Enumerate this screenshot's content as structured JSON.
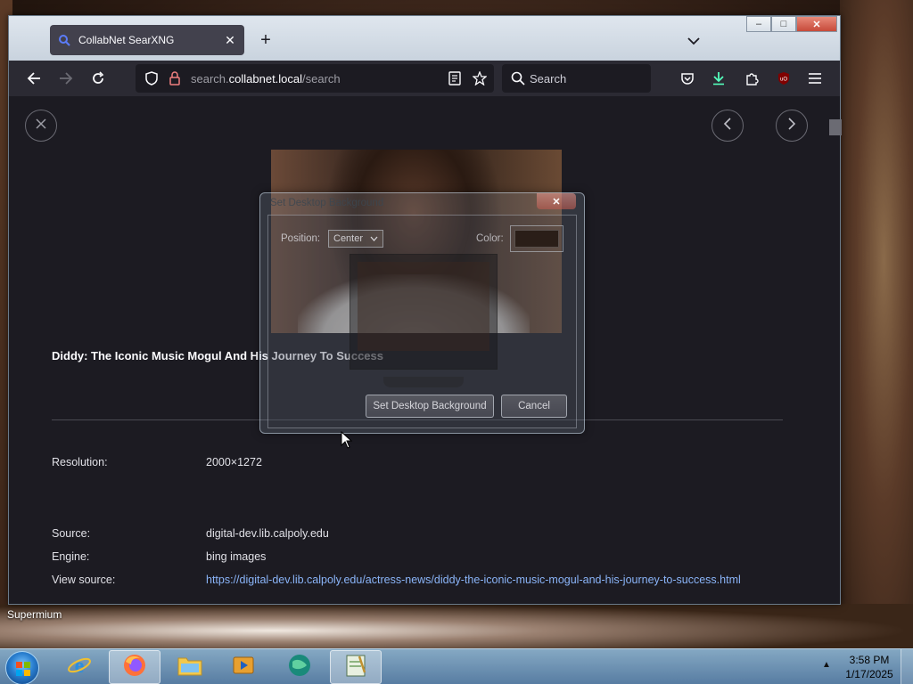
{
  "browser": {
    "tab_title": "CollabNet SearXNG",
    "url_prefix": "search.",
    "url_host": "collabnet.local",
    "url_path": "/search",
    "search_placeholder": "Search"
  },
  "result": {
    "title": "Diddy: The Iconic Music Mogul And His Journey To Success",
    "resolution_label": "Resolution:",
    "resolution_value": "2000×1272",
    "source_label": "Source:",
    "source_value": "digital-dev.lib.calpoly.edu",
    "engine_label": "Engine:",
    "engine_value": "bing images",
    "view_source_label": "View source:",
    "view_source_url": "https://digital-dev.lib.calpoly.edu/actress-news/diddy-the-iconic-music-mogul-and-his-journey-to-success.html"
  },
  "dialog": {
    "title": "Set Desktop Background",
    "position_label": "Position:",
    "position_value": "Center",
    "color_label": "Color:",
    "color_value": "#2a1e18",
    "set_button": "Set Desktop Background",
    "cancel_button": "Cancel"
  },
  "desktop": {
    "icon_label": "Supermium"
  },
  "taskbar": {
    "time": "3:58 PM",
    "date": "1/17/2025"
  }
}
